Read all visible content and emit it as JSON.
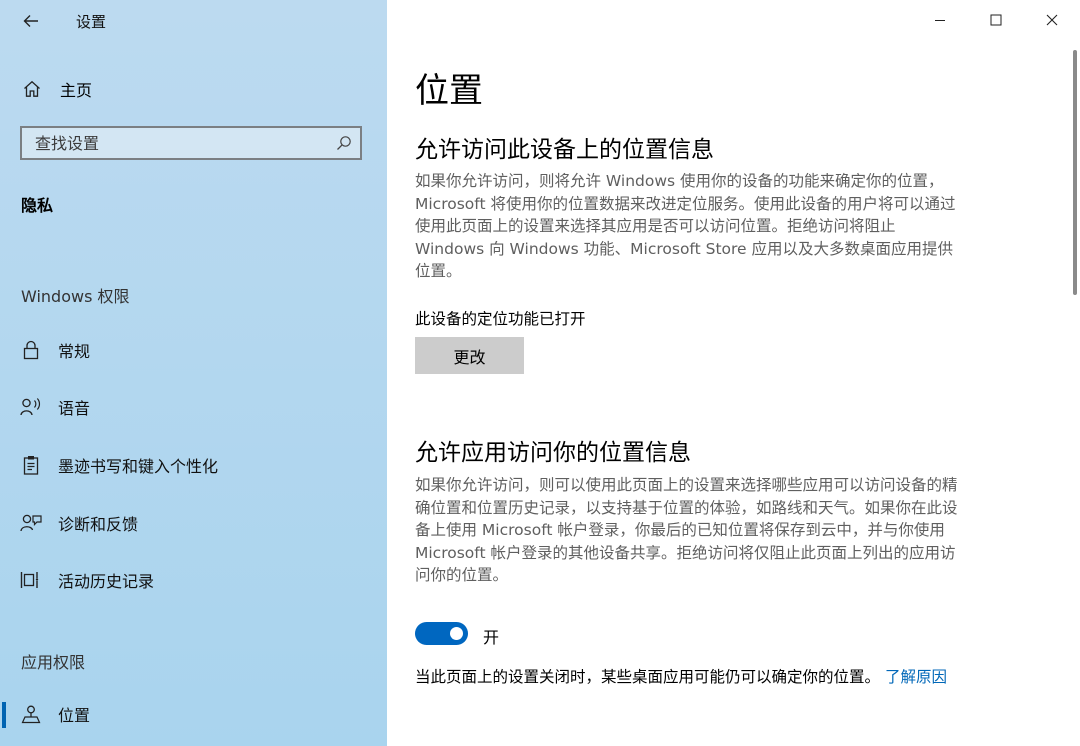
{
  "window": {
    "title": "设置",
    "icons": {
      "back": "back-arrow-icon",
      "minimize": "minimize-icon",
      "maximize": "maximize-icon",
      "close": "close-icon"
    }
  },
  "sidebar": {
    "home_label": "主页",
    "search_placeholder": "查找设置",
    "current_section": "隐私",
    "groups": [
      {
        "label": "Windows 权限",
        "items": [
          {
            "label": "常规",
            "icon": "lock-icon"
          },
          {
            "label": "语音",
            "icon": "speech-icon"
          },
          {
            "label": "墨迹书写和键入个性化",
            "icon": "clipboard-icon"
          },
          {
            "label": "诊断和反馈",
            "icon": "feedback-icon"
          },
          {
            "label": "活动历史记录",
            "icon": "timeline-icon"
          }
        ]
      },
      {
        "label": "应用权限",
        "items": [
          {
            "label": "位置",
            "icon": "location-icon",
            "selected": true
          }
        ]
      }
    ]
  },
  "content": {
    "title": "位置",
    "section1": {
      "heading": "允许访问此设备上的位置信息",
      "description": "如果你允许访问，则将允许 Windows 使用你的设备的功能来确定你的位置，Microsoft 将使用你的位置数据来改进定位服务。使用此设备的用户将可以通过使用此页面上的设置来选择其应用是否可以访问位置。拒绝访问将阻止 Windows 向 Windows 功能、Microsoft Store 应用以及大多数桌面应用提供位置。",
      "status": "此设备的定位功能已打开",
      "button_label": "更改"
    },
    "section2": {
      "heading": "允许应用访问你的位置信息",
      "description": "如果你允许访问，则可以使用此页面上的设置来选择哪些应用可以访问设备的精确位置和位置历史记录，以支持基于位置的体验，如路线和天气。如果你在此设备上使用 Microsoft 帐户登录，你最后的已知位置将保存到云中，并与你使用 Microsoft 帐户登录的其他设备共享。拒绝访问将仅阻止此页面上列出的应用访问你的位置。",
      "toggle_state": "开",
      "toggle_on": true,
      "note": "当此页面上的设置关闭时，某些桌面应用可能仍可以确定你的位置。",
      "link": "了解原因"
    }
  }
}
